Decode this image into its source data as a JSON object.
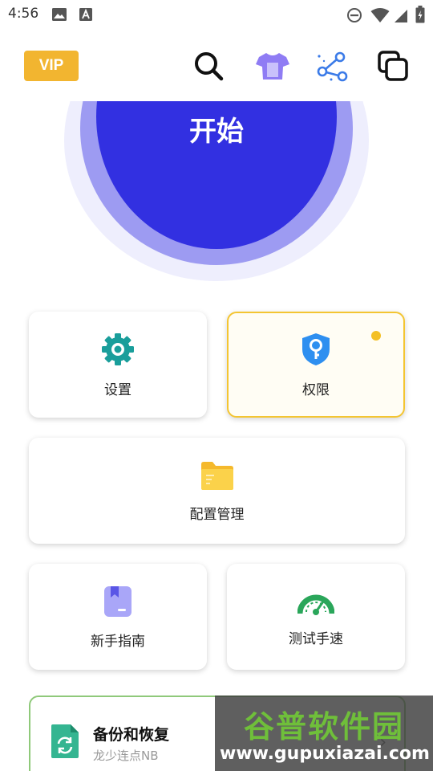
{
  "status_bar": {
    "time": "4:56"
  },
  "top_bar": {
    "vip_label": "VIP"
  },
  "start": {
    "label": "开始"
  },
  "menu": {
    "settings_label": "设置",
    "permission_label": "权限",
    "config_label": "配置管理",
    "guide_label": "新手指南",
    "speed_label": "测试手速"
  },
  "backup": {
    "title": "备份和恢复",
    "subtitle": "龙少连点NB"
  },
  "watermark": {
    "title": "谷普软件园",
    "url": "www.gupuxiazai.com"
  },
  "colors": {
    "primary": "#3230e1",
    "vip": "#f2b530",
    "settings_icon": "#1a9e9b",
    "permission_icon": "#2e8ff0",
    "folder_icon": "#f7c23a",
    "guide_icon": "#a7a5f7",
    "speed_icon": "#2aa65a",
    "backup_icon": "#34b591"
  }
}
